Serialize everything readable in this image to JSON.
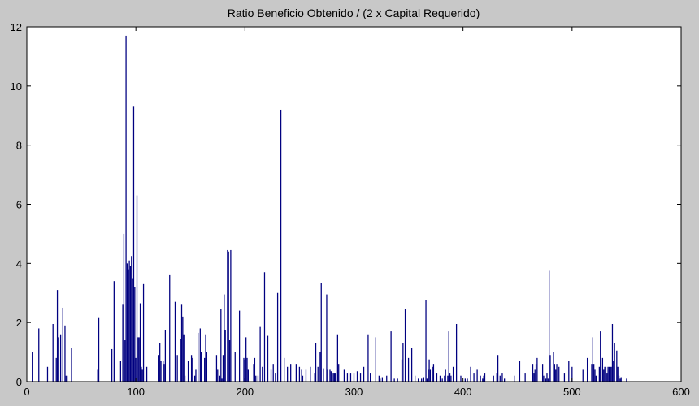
{
  "chart_data": {
    "type": "bar",
    "title": "Ratio Beneficio Obtenido / (2 x Capital Requerido)",
    "xlabel": "",
    "ylabel": "",
    "xlim": [
      0,
      600
    ],
    "ylim": [
      0,
      12
    ],
    "xticks": [
      0,
      100,
      200,
      300,
      400,
      500,
      600
    ],
    "yticks": [
      0,
      2,
      4,
      6,
      8,
      10,
      12
    ],
    "grid": false,
    "legend": "none",
    "bar_color": "#000080",
    "background_color": "#c8c8c8",
    "plot_color": "#ffffff",
    "x": [
      5,
      11,
      19,
      24,
      27,
      28,
      29,
      31,
      33,
      35,
      36,
      37,
      41,
      65,
      66,
      78,
      80,
      86,
      88,
      89,
      90,
      91,
      92,
      93,
      94,
      95,
      96,
      97,
      98,
      99,
      100,
      101,
      102,
      103,
      104,
      105,
      106,
      107,
      110,
      121,
      122,
      123,
      125,
      126,
      127,
      131,
      136,
      138,
      141,
      142,
      143,
      144,
      145,
      148,
      151,
      152,
      154,
      155,
      157,
      159,
      160,
      163,
      164,
      165,
      174,
      175,
      177,
      178,
      179,
      180,
      181,
      182,
      184,
      185,
      186,
      187,
      191,
      195,
      199,
      200,
      201,
      202,
      203,
      208,
      209,
      210,
      212,
      214,
      216,
      218,
      221,
      224,
      226,
      228,
      230,
      233,
      236,
      239,
      242,
      247,
      250,
      252,
      253,
      256,
      260,
      264,
      265,
      267,
      269,
      270,
      272,
      275,
      276,
      278,
      279,
      281,
      282,
      283,
      285,
      286,
      291,
      294,
      297,
      300,
      303,
      306,
      309,
      313,
      315,
      320,
      323,
      324,
      326,
      330,
      334,
      337,
      340,
      344,
      345,
      347,
      350,
      353,
      356,
      359,
      362,
      364,
      366,
      367,
      368,
      369,
      370,
      372,
      373,
      376,
      379,
      381,
      383,
      384,
      386,
      387,
      388,
      389,
      391,
      394,
      398,
      402,
      404,
      407,
      410,
      413,
      416,
      418,
      419,
      420,
      428,
      431,
      432,
      434,
      436,
      438,
      447,
      452,
      457,
      464,
      465,
      466,
      467,
      468,
      473,
      474,
      476,
      477,
      478,
      479,
      480,
      483,
      484,
      485,
      486,
      488,
      493,
      497,
      500,
      510,
      514,
      518,
      519,
      520,
      521,
      522,
      525,
      526,
      528,
      529,
      530,
      531,
      532,
      533,
      534,
      535,
      536,
      537,
      538,
      539,
      541,
      542,
      543,
      544,
      545,
      550,
      555,
      556,
      557,
      558,
      559,
      560
    ],
    "values": [
      1.0,
      1.8,
      0.5,
      1.95,
      0.8,
      3.1,
      1.5,
      1.6,
      2.5,
      1.9,
      0.2,
      0.2,
      1.15,
      0.4,
      2.15,
      1.1,
      3.4,
      0.7,
      2.6,
      5.0,
      1.4,
      11.7,
      4.0,
      3.8,
      4.1,
      3.9,
      4.25,
      3.5,
      9.3,
      3.2,
      0.8,
      6.3,
      1.5,
      1.5,
      2.65,
      0.5,
      0.4,
      3.3,
      0.5,
      0.9,
      1.3,
      0.7,
      0.7,
      0.6,
      1.75,
      3.6,
      2.7,
      0.9,
      1.45,
      2.6,
      2.2,
      1.6,
      0.2,
      0.7,
      0.9,
      0.8,
      0.2,
      0.4,
      1.65,
      1.8,
      1.0,
      0.8,
      1.6,
      1.0,
      0.9,
      0.4,
      0.2,
      2.45,
      0.1,
      0.9,
      2.95,
      1.75,
      4.45,
      4.4,
      1.4,
      4.45,
      1.0,
      2.4,
      0.8,
      0.75,
      1.5,
      0.8,
      0.4,
      0.6,
      0.8,
      0.2,
      0.2,
      1.85,
      0.5,
      3.7,
      1.55,
      0.4,
      0.6,
      0.3,
      3.0,
      9.2,
      0.8,
      0.5,
      0.6,
      0.6,
      0.5,
      0.4,
      0.2,
      0.4,
      0.5,
      0.3,
      1.3,
      0.5,
      1.0,
      3.35,
      0.45,
      2.95,
      0.4,
      0.4,
      0.35,
      0.3,
      0.3,
      0.3,
      1.6,
      0.6,
      0.4,
      0.3,
      0.3,
      0.3,
      0.35,
      0.3,
      0.5,
      1.6,
      0.3,
      1.5,
      0.2,
      0.1,
      0.15,
      0.2,
      1.7,
      0.1,
      0.1,
      0.75,
      1.3,
      2.45,
      0.8,
      1.15,
      0.2,
      0.1,
      0.1,
      0.15,
      2.75,
      0.1,
      0.4,
      0.75,
      0.4,
      0.5,
      0.6,
      0.3,
      0.2,
      0.1,
      0.2,
      0.4,
      0.2,
      1.7,
      0.3,
      0.2,
      0.5,
      1.95,
      0.2,
      0.1,
      0.1,
      0.5,
      0.3,
      0.4,
      0.2,
      0.1,
      0.2,
      0.3,
      0.2,
      0.3,
      0.9,
      0.2,
      0.3,
      0.1,
      0.2,
      0.7,
      0.3,
      0.6,
      0.3,
      0.4,
      0.6,
      0.8,
      0.6,
      0.2,
      0.1,
      0.3,
      0.1,
      3.75,
      0.9,
      1.0,
      0.6,
      0.4,
      0.6,
      0.5,
      0.3,
      0.7,
      0.5,
      0.4,
      0.8,
      0.6,
      1.5,
      0.6,
      0.4,
      0.2,
      0.5,
      1.7,
      0.8,
      0.4,
      0.5,
      0.5,
      0.3,
      0.5,
      0.5,
      0.5,
      0.5,
      1.95,
      0.7,
      1.3,
      1.05,
      0.5,
      0.2,
      0.1,
      0.15,
      0.1
    ]
  }
}
